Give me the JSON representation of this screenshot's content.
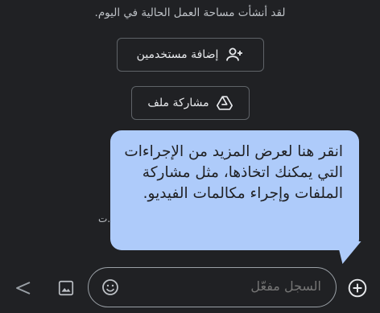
{
  "chat": {
    "intro_text": "لقد أنشأت مساحة العمل الحالية في اليوم.",
    "add_people_label": "إضافة مستخدمين",
    "share_file_label": "مشاركة ملف",
    "partial_hidden_text": "ت."
  },
  "tooltip": {
    "text": "انقر هنا لعرض المزيد من الإجراءات التي يمكنك اتخاذها، مثل مشاركة الملفات وإجراء مكالمات الفيديو."
  },
  "composer": {
    "placeholder": "السجل مفعّل"
  },
  "icons": {
    "add_people": "person-add-icon",
    "share_file": "drive-icon",
    "send": "send-icon",
    "image": "image-icon",
    "emoji": "emoji-icon",
    "add": "add-circle-icon"
  },
  "colors": {
    "background": "#202124",
    "tooltip_bg": "#aecbfa",
    "text_secondary": "#bdc1c6",
    "border": "#5f6368"
  }
}
